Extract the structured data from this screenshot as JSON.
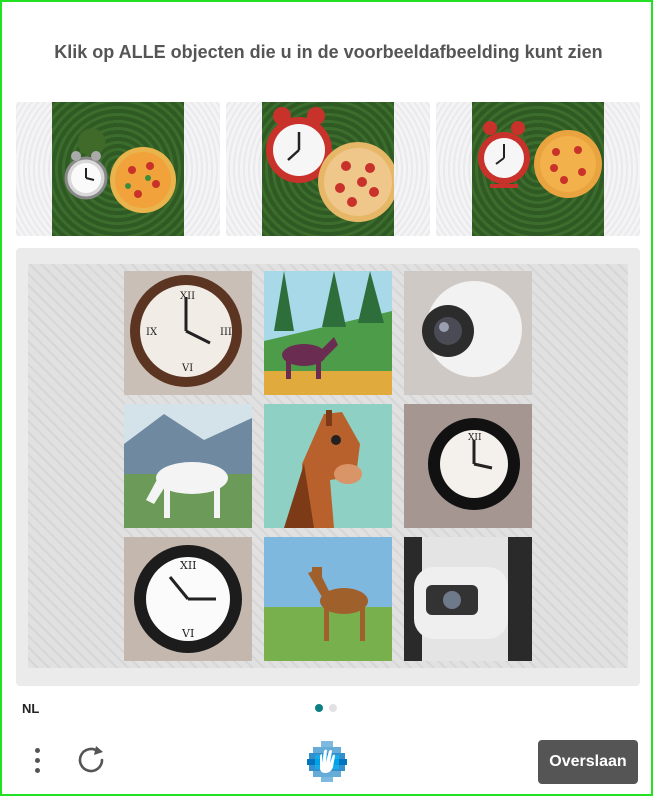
{
  "prompt": "Klik op ALLE objecten die u in de voorbeeldafbeelding kunt zien",
  "examples": [
    {
      "depicts": "clock-and-pizza"
    },
    {
      "depicts": "clock-and-pizza"
    },
    {
      "depicts": "clock-and-pizza"
    }
  ],
  "tiles": [
    {
      "depicts": "clock"
    },
    {
      "depicts": "horse"
    },
    {
      "depicts": "security-camera"
    },
    {
      "depicts": "horse"
    },
    {
      "depicts": "horse"
    },
    {
      "depicts": "clock"
    },
    {
      "depicts": "clock"
    },
    {
      "depicts": "horse"
    },
    {
      "depicts": "security-camera"
    }
  ],
  "footer": {
    "language": "NL",
    "page_count": 2,
    "active_page": 1,
    "skip_label": "Overslaan",
    "menu_icon": "more-vertical-icon",
    "refresh_icon": "refresh-icon",
    "logo_icon": "hcaptcha-logo"
  },
  "colors": {
    "accent": "#0d7f83",
    "button_bg": "#555555",
    "border": "#22e022",
    "prompt_text": "#555555"
  }
}
